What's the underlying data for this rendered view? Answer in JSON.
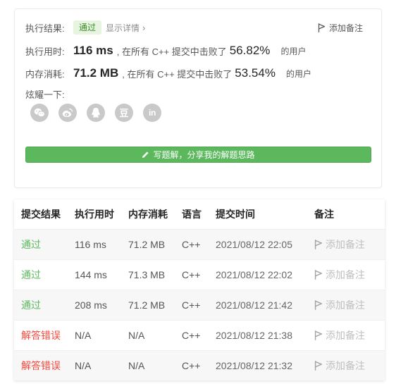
{
  "summary": {
    "result": {
      "label": "执行结果:",
      "badge": "通过",
      "details_link": "显示详情",
      "details_chevron": "›"
    },
    "add_note": "添加备注",
    "runtime": {
      "label": "执行用时:",
      "value": "116 ms",
      "beat_text": ", 在所有 C++ 提交中击败了",
      "percent": "56.82%",
      "suffix": "的用户"
    },
    "memory": {
      "label": "内存消耗:",
      "value": "71.2 MB",
      "beat_text": ", 在所有 C++ 提交中击败了",
      "percent": "53.54%",
      "suffix": "的用户"
    },
    "share": {
      "label": "炫耀一下:",
      "icons": [
        {
          "icon": "wechat-icon"
        },
        {
          "icon": "weibo-icon"
        },
        {
          "icon": "qq-icon"
        },
        {
          "icon": "douban-icon",
          "glyph": "豆"
        },
        {
          "icon": "linkedin-icon",
          "glyph": "in"
        }
      ]
    },
    "write_solution": {
      "icon": "pencil-icon",
      "label": "写题解，分享我的解题思路"
    }
  },
  "submissions": {
    "headers": [
      "提交结果",
      "执行用时",
      "内存消耗",
      "语言",
      "提交时间",
      "备注"
    ],
    "rows": [
      {
        "status": "通过",
        "status_color": "#5cb85c",
        "runtime": "116 ms",
        "memory": "71.2 MB",
        "language": "C++",
        "time": "2021/08/12 22:05",
        "note": "添加备注"
      },
      {
        "status": "通过",
        "status_color": "#5cb85c",
        "runtime": "144 ms",
        "memory": "71.3 MB",
        "language": "C++",
        "time": "2021/08/12 22:02",
        "note": "添加备注"
      },
      {
        "status": "通过",
        "status_color": "#5cb85c",
        "runtime": "208 ms",
        "memory": "71.2 MB",
        "language": "C++",
        "time": "2021/08/12 21:42",
        "note": "添加备注"
      },
      {
        "status": "解答错误",
        "status_color": "#f0483e",
        "runtime": "N/A",
        "memory": "N/A",
        "language": "C++",
        "time": "2021/08/12 21:38",
        "note": "添加备注"
      },
      {
        "status": "解答错误",
        "status_color": "#f0483e",
        "runtime": "N/A",
        "memory": "N/A",
        "language": "C++",
        "time": "2021/08/12 21:32",
        "note": "添加备注"
      }
    ]
  },
  "colors": {
    "accepted_green": "#5cb85c",
    "error_red": "#f0483e",
    "badge_bg": "#e7f4df",
    "share_icon_gray": "#c9c9c9",
    "button_green": "#5cb85c"
  }
}
